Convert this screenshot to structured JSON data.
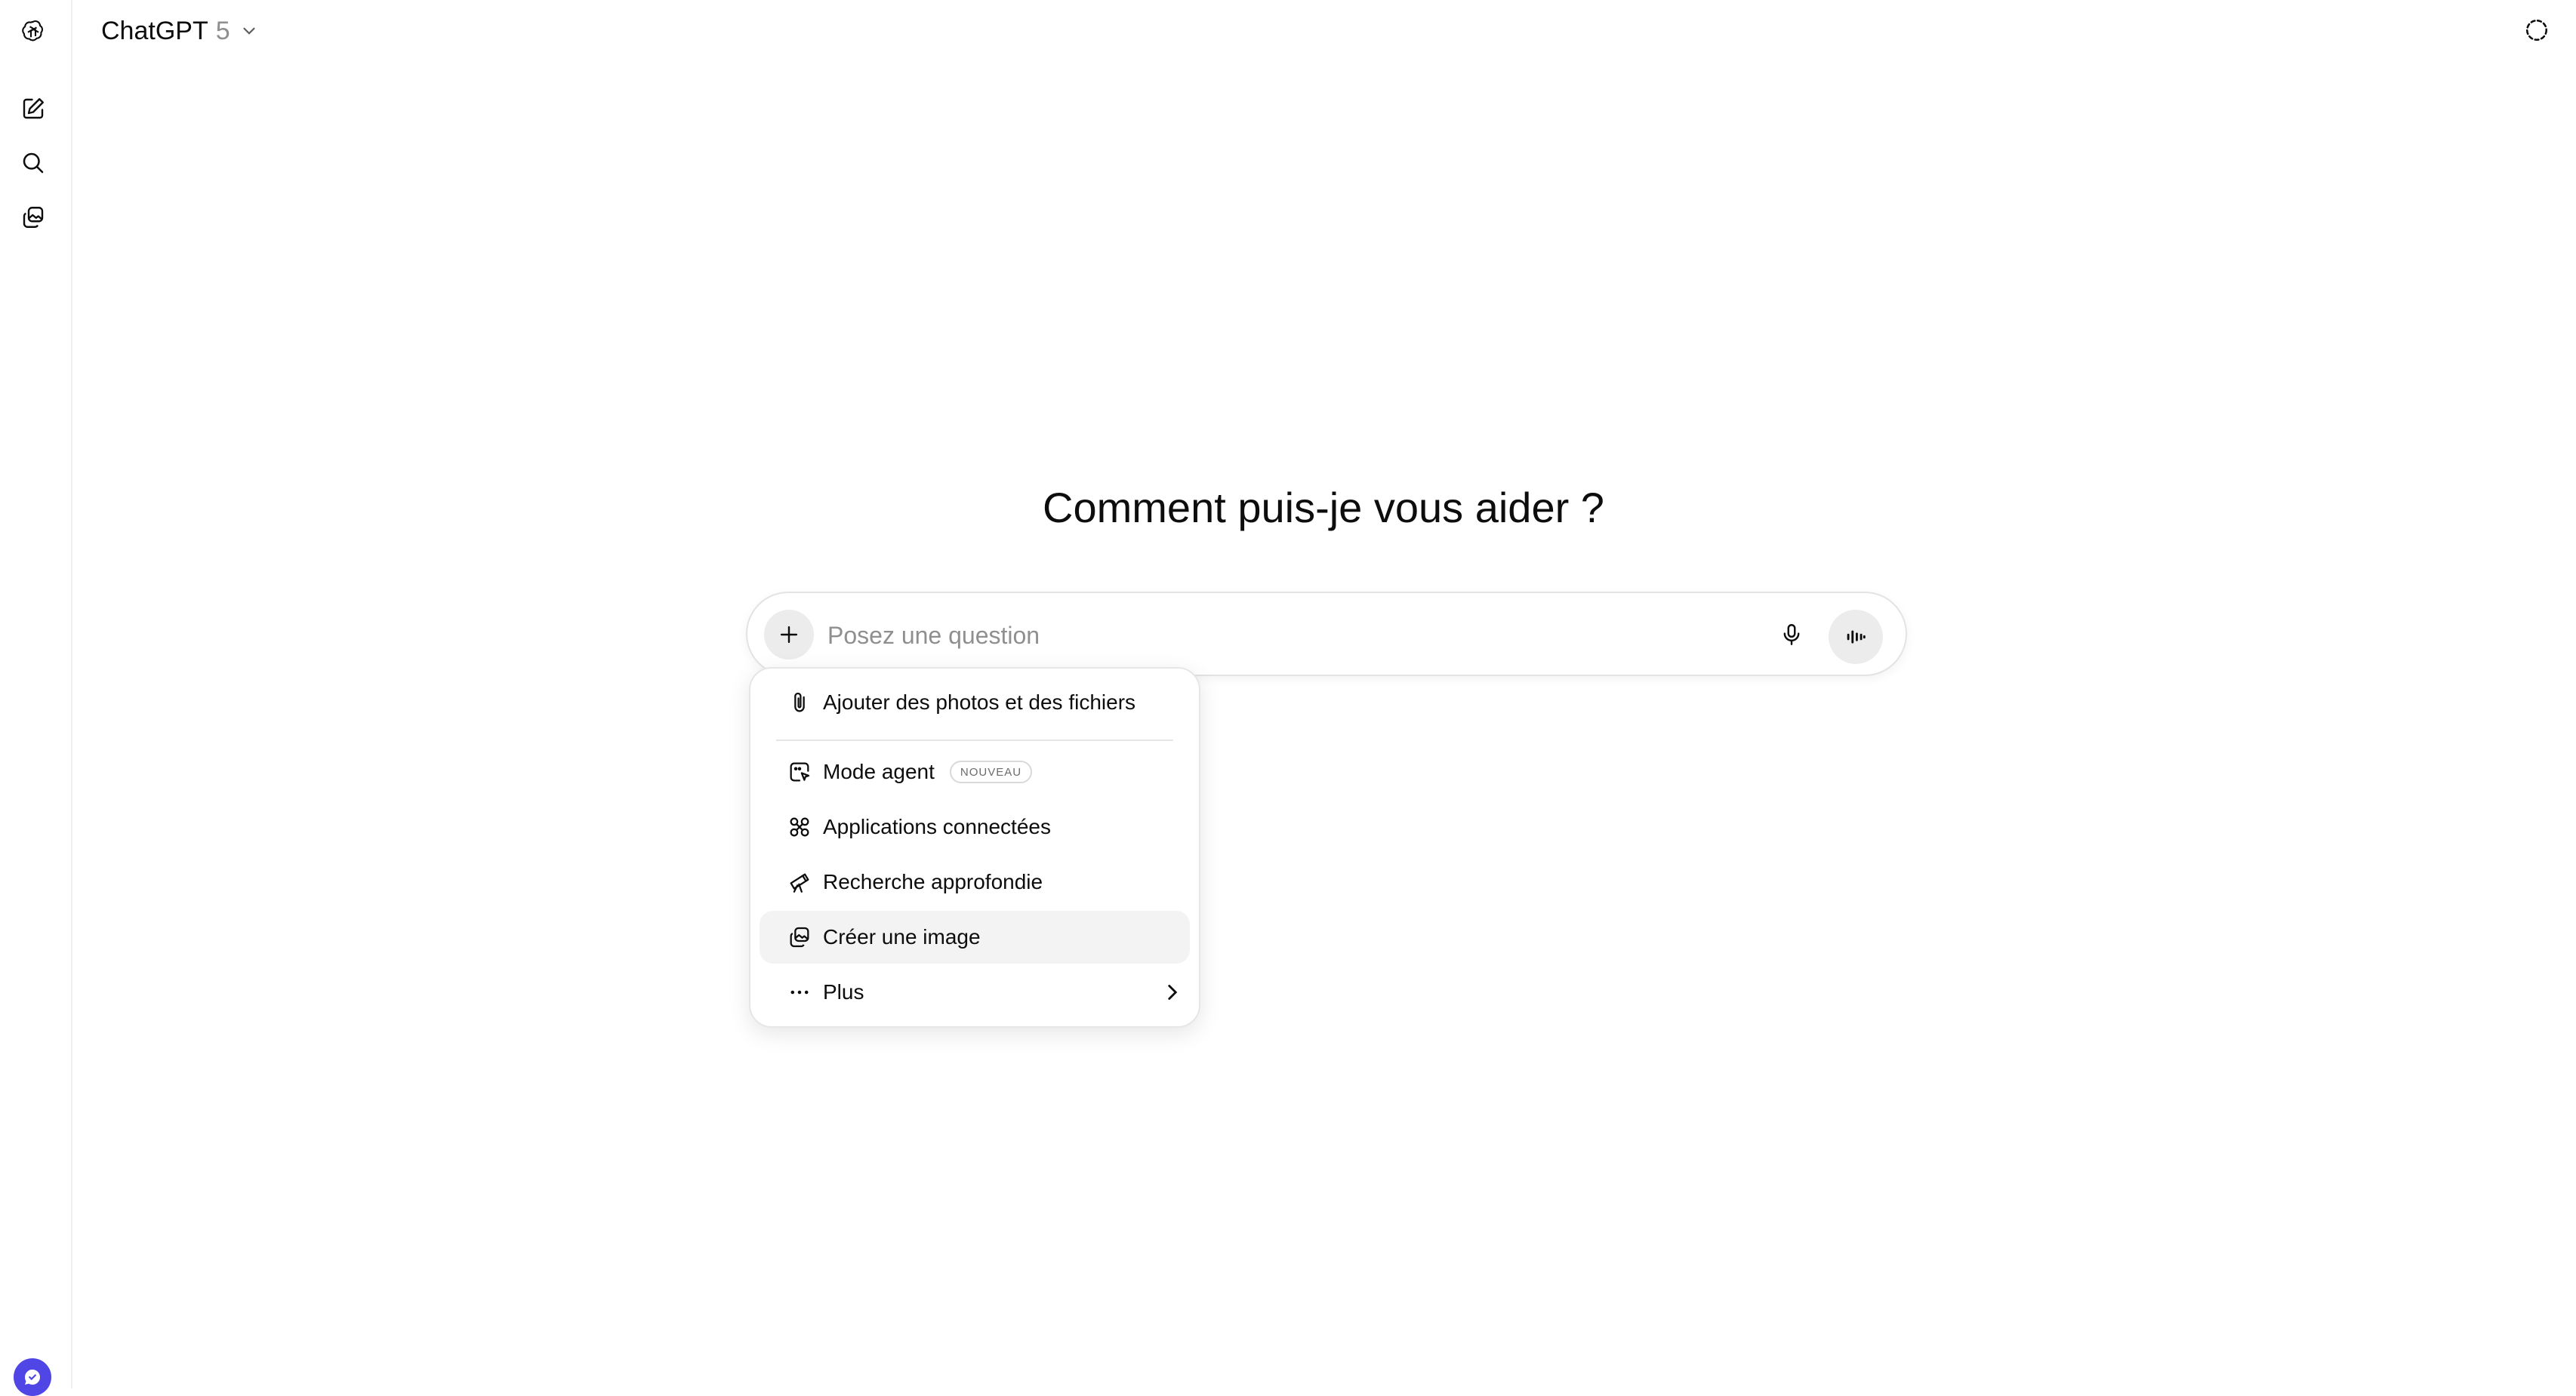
{
  "header": {
    "model_name": "ChatGPT",
    "model_version": "5"
  },
  "main": {
    "heading": "Comment puis-je vous aider ?"
  },
  "composer": {
    "placeholder": "Posez une question"
  },
  "attach_menu": {
    "items": [
      {
        "label": "Ajouter des photos et des fichiers",
        "icon": "paperclip-icon"
      },
      {
        "label": "Mode agent",
        "icon": "agent-icon",
        "badge": "NOUVEAU"
      },
      {
        "label": "Applications connectées",
        "icon": "apps-icon"
      },
      {
        "label": "Recherche approfondie",
        "icon": "telescope-icon"
      },
      {
        "label": "Créer une image",
        "icon": "image-icon",
        "highlighted": true
      },
      {
        "label": "Plus",
        "icon": "more-icon",
        "has_submenu": true
      }
    ]
  },
  "colors": {
    "accent_avatar": "#4f46e5",
    "highlight_bg": "#f3f3f3",
    "placeholder": "#8f8f8f"
  }
}
